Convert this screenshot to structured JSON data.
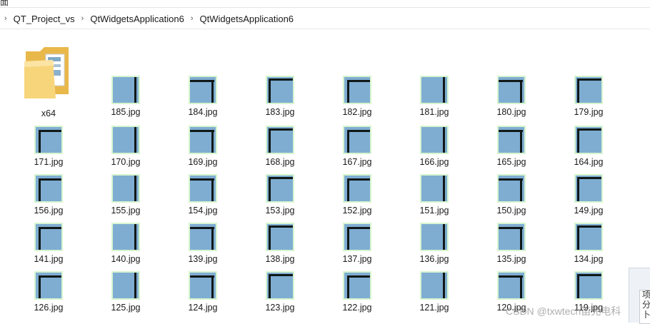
{
  "window": {
    "top_fragment": "面"
  },
  "breadcrumb": [
    {
      "label": "QT_Project_vs"
    },
    {
      "label": "QtWidgetsApplication6"
    },
    {
      "label": "QtWidgetsApplication6"
    }
  ],
  "folder": {
    "name": "x64"
  },
  "rows": [
    [
      "185.jpg",
      "184.jpg",
      "183.jpg",
      "182.jpg",
      "181.jpg",
      "180.jpg",
      "179.jpg"
    ],
    [
      "171.jpg",
      "170.jpg",
      "169.jpg",
      "168.jpg",
      "167.jpg",
      "166.jpg",
      "165.jpg",
      "164.jpg"
    ],
    [
      "156.jpg",
      "155.jpg",
      "154.jpg",
      "153.jpg",
      "152.jpg",
      "151.jpg",
      "150.jpg",
      "149.jpg"
    ],
    [
      "141.jpg",
      "140.jpg",
      "139.jpg",
      "138.jpg",
      "137.jpg",
      "136.jpg",
      "135.jpg",
      "134.jpg"
    ],
    [
      "126.jpg",
      "125.jpg",
      "124.jpg",
      "123.jpg",
      "122.jpg",
      "121.jpg",
      "120.jpg",
      "119.jpg"
    ]
  ],
  "side_popup": {
    "items": [
      "项",
      "分",
      "卜"
    ]
  },
  "watermark": "CSDN @txwtech笛克电科",
  "colors": {
    "thumb_bg": "#d7f5cf",
    "thumb_blue": "#7fadd2",
    "folder": "#f4c95d"
  }
}
